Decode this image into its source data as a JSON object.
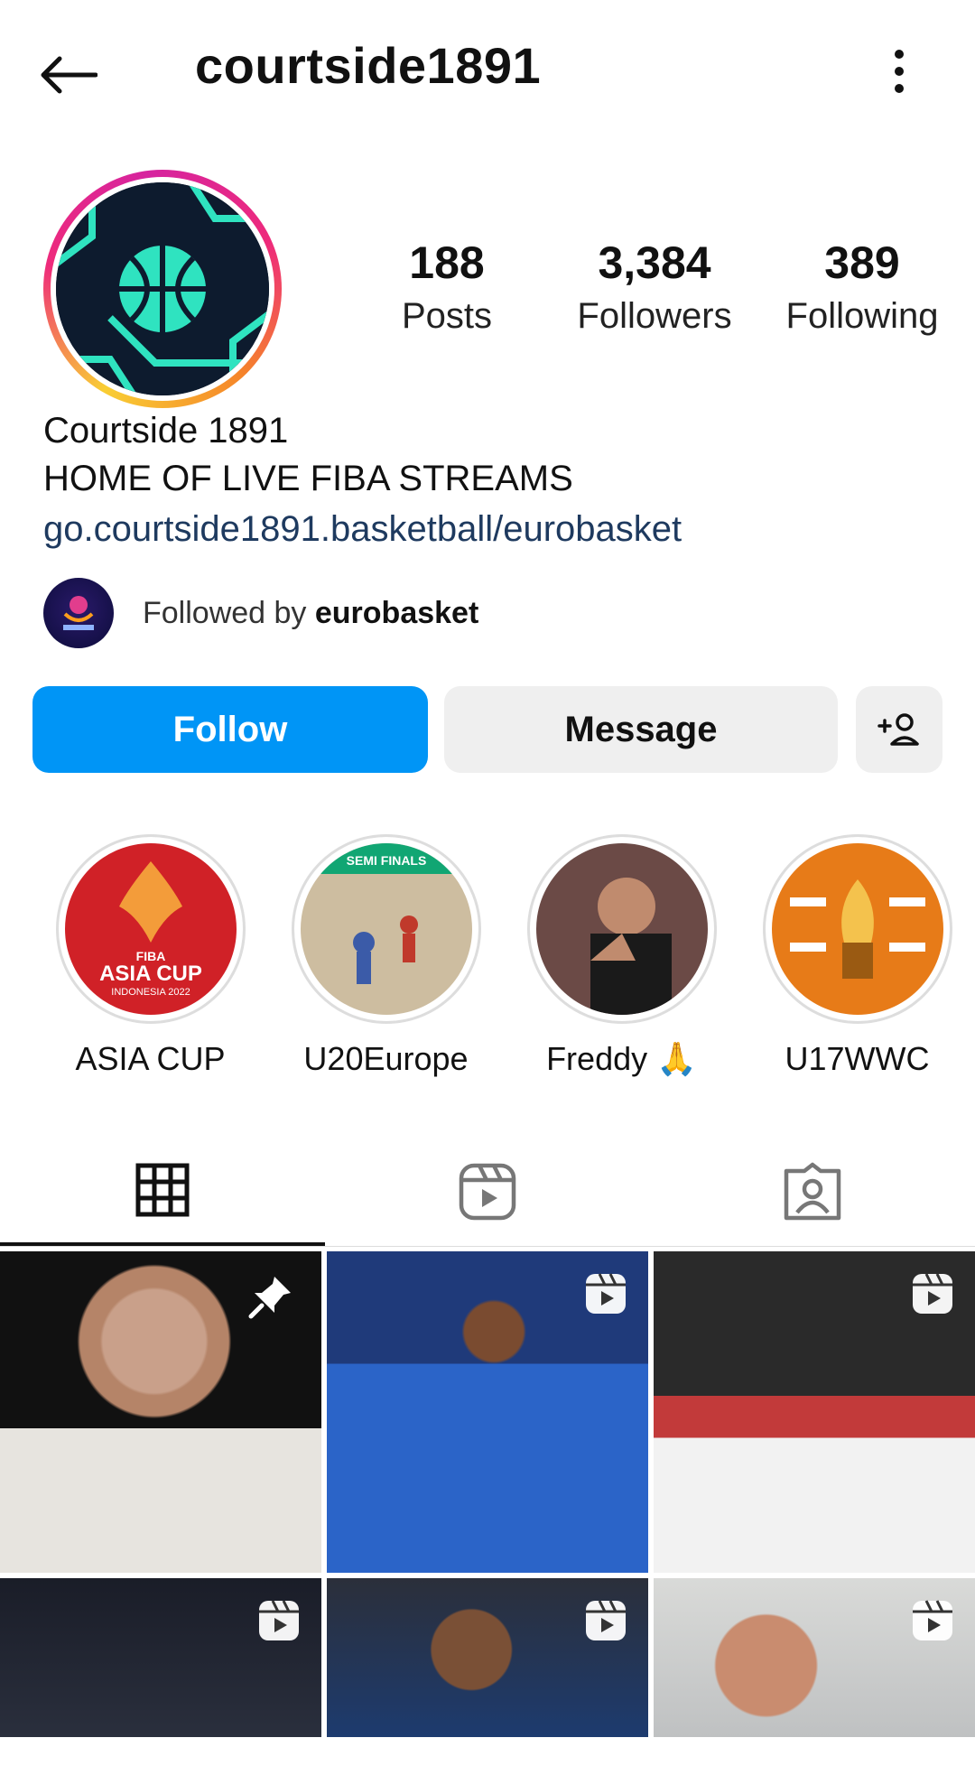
{
  "header": {
    "username": "courtside1891",
    "back_icon": "arrow-left-icon",
    "more_icon": "more-vertical-icon"
  },
  "profile": {
    "display_name": "Courtside 1891",
    "bio": "HOME OF LIVE FIBA STREAMS",
    "link": "go.courtside1891.basketball/eurobasket",
    "stats": [
      {
        "value": "188",
        "label": "Posts"
      },
      {
        "value": "3,384",
        "label": "Followers"
      },
      {
        "value": "389",
        "label": "Following"
      }
    ],
    "followed_by_prefix": "Followed by",
    "followed_by_user": "eurobasket"
  },
  "actions": {
    "follow_label": "Follow",
    "message_label": "Message"
  },
  "highlights": [
    {
      "label": "ASIA CUP"
    },
    {
      "label": "U20Europe"
    },
    {
      "label": "Freddy 🙏"
    },
    {
      "label": "U17WWC"
    }
  ],
  "tabs": [
    {
      "icon": "grid-icon",
      "active": true
    },
    {
      "icon": "reels-icon",
      "active": false
    },
    {
      "icon": "tagged-icon",
      "active": false
    }
  ],
  "highlight_text": {
    "asia_cup_line1": "FIBA",
    "asia_cup_line2": "ASIA CUP",
    "asia_cup_line3": "INDONESIA 2022",
    "u20_banner": "SEMI FINALS"
  },
  "colors": {
    "follow_button": "#0095f6",
    "link": "#1e3a5f",
    "avatar_bg": "#0d1b2e",
    "avatar_accent": "#2fe3c0"
  }
}
